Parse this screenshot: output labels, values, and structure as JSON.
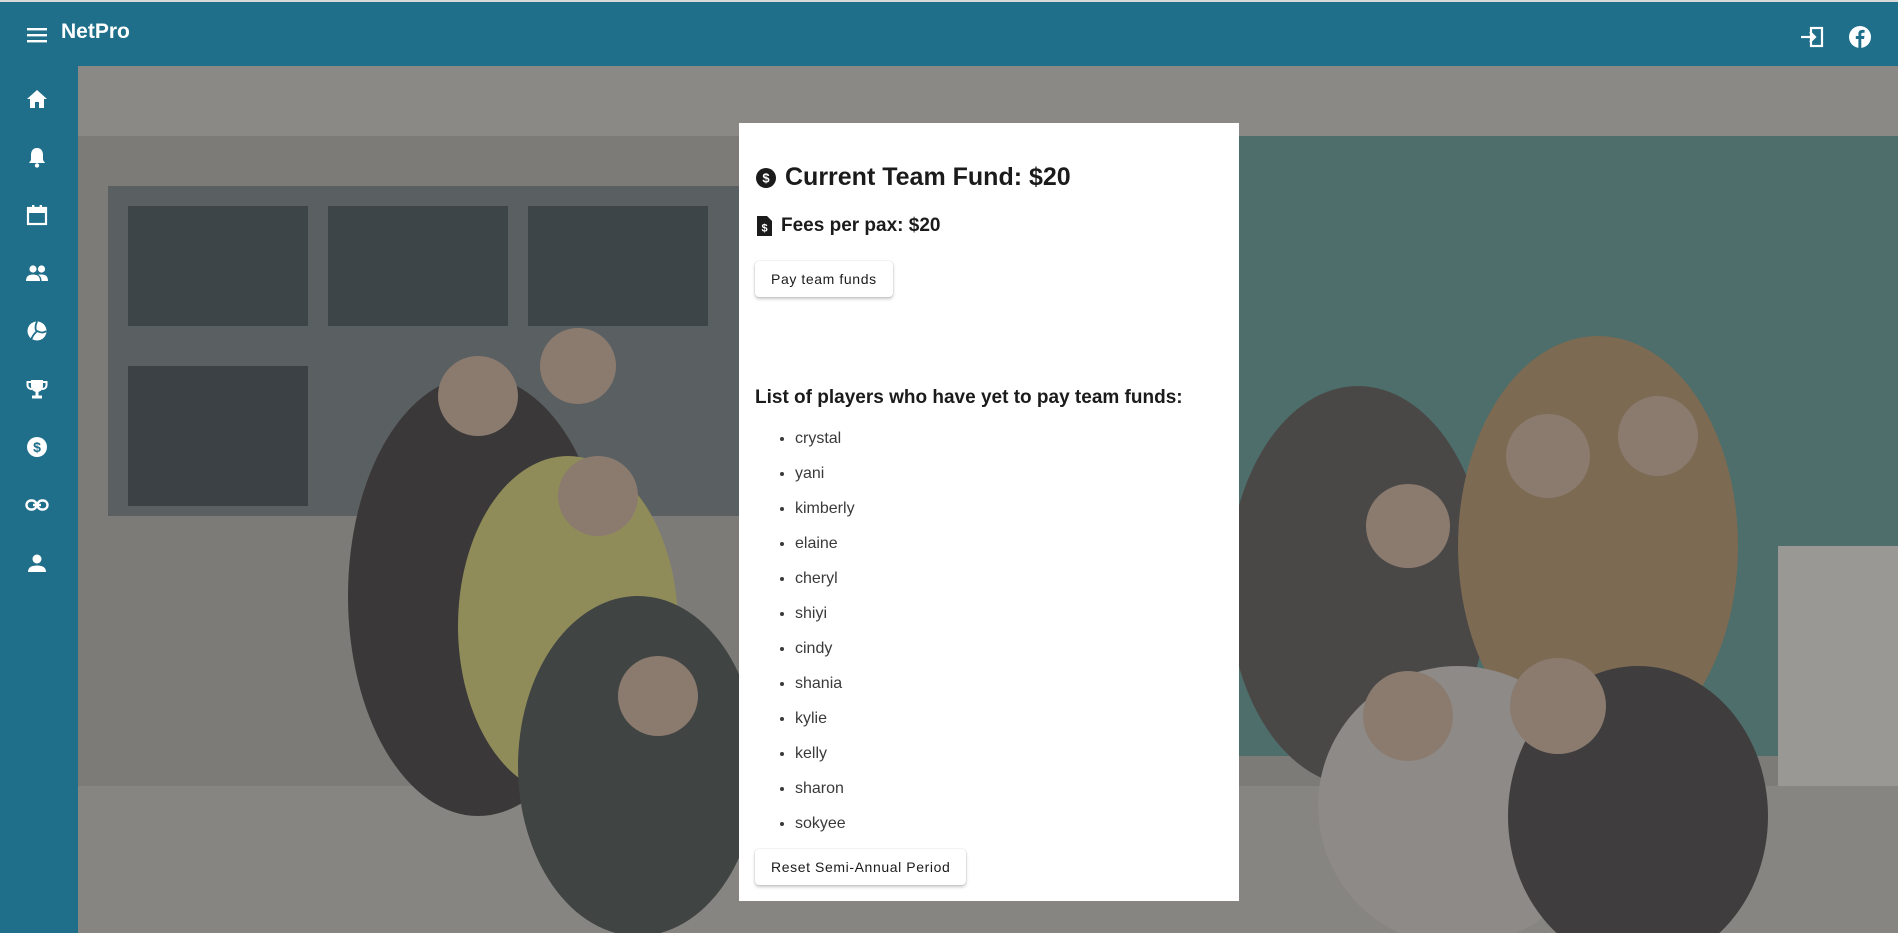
{
  "app": {
    "name": "NetPro"
  },
  "topbar": {
    "icons": [
      "menu-icon",
      "login-icon",
      "facebook-icon"
    ]
  },
  "sidebar": {
    "items": [
      {
        "icon": "home-icon"
      },
      {
        "icon": "bell-icon"
      },
      {
        "icon": "calendar-icon"
      },
      {
        "icon": "people-icon"
      },
      {
        "icon": "volleyball-icon"
      },
      {
        "icon": "trophy-icon"
      },
      {
        "icon": "dollar-icon"
      },
      {
        "icon": "link-icon"
      },
      {
        "icon": "person-icon"
      }
    ]
  },
  "fund": {
    "title": "Current Team Fund: $20",
    "fees": "Fees per pax: $20",
    "pay_button": "Pay team funds",
    "list_title": "List of players who have yet to pay team funds:",
    "players": [
      "crystal",
      "yani",
      "kimberly",
      "elaine",
      "cheryl",
      "shiyi",
      "cindy",
      "shania",
      "kylie",
      "kelly",
      "sharon",
      "sokyee"
    ],
    "reset_button": "Reset Semi-Annual Period"
  },
  "colors": {
    "primary": "#1f6e8a",
    "card": "#ffffff"
  }
}
